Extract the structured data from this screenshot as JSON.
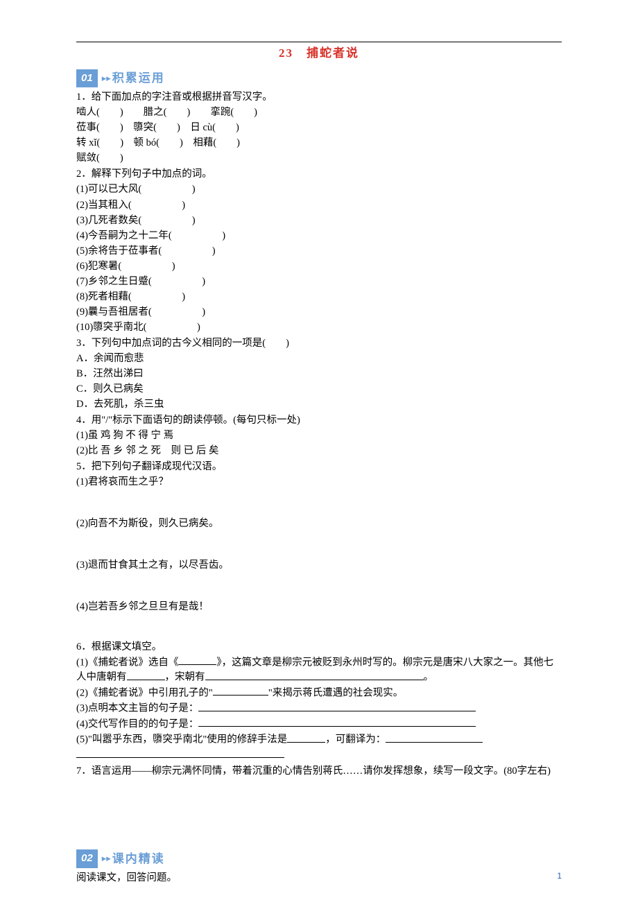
{
  "title": "23　捕蛇者说",
  "section01": {
    "num": "01",
    "label": "积累运用"
  },
  "section02": {
    "num": "02",
    "label": "课内精读"
  },
  "q1": {
    "stem": "1．给下面加点的字注音或根据拼音写汉字。",
    "row1": "啮人(　　)　　腊之(　　)　　挛踠(　　)",
    "row2": "莅事(　　)　隳突(　　)　日 cù(　　)",
    "row3": "转 xǐ(　　)　顿 bó(　　)　相藉(　　)",
    "row4": "赋敛(　　)"
  },
  "q2": {
    "stem": "2．解释下列句子中加点的词。",
    "i1": "(1)可以已大风(　　　　　)",
    "i2": "(2)当其租入(　　　　　)",
    "i3": "(3)几死者数矣(　　　　　)",
    "i4": "(4)今吾嗣为之十二年(　　　　　)",
    "i5": "(5)余将告于莅事者(　　　　　)",
    "i6": "(6)犯寒暑(　　　　　)",
    "i7": "(7)乡邻之生日蹙(　　　　　)",
    "i8": "(8)死者相藉(　　　　　)",
    "i9": "(9)曩与吾祖居者(　　　　　)",
    "i10": "(10)隳突乎南北(　　　　　)"
  },
  "q3": {
    "stem": "3．下列句中加点词的古今义相同的一项是(　　)",
    "a": "A．余闻而愈悲",
    "b": "B．汪然出涕曰",
    "c": "C．则久已病矣",
    "d": "D．去死肌，杀三虫"
  },
  "q4": {
    "stem": "4．用\"/\"标示下面语句的朗读停顿。(每句只标一处)",
    "i1": "(1)虽 鸡 狗 不 得 宁 焉",
    "i2": "(2)比 吾 乡 邻 之 死　则 已 后 矣"
  },
  "q5": {
    "stem": "5．把下列句子翻译成现代汉语。",
    "i1": "(1)君将哀而生之乎？",
    "i2": "(2)向吾不为斯役，则久已病矣。",
    "i3": "(3)退而甘食其土之有，以尽吾齿。",
    "i4": "(4)岂若吾乡邻之旦旦有是哉！"
  },
  "q6": {
    "stem": "6．根据课文填空。",
    "i1a": "(1)《捕蛇者说》选自《",
    "i1b": "》，这篇文章是柳宗元被贬到永州时写的。柳宗元是唐宋八大家之一。其他七人中唐朝有",
    "i1c": "，宋朝有",
    "i1d": "。",
    "i2a": "(2)《捕蛇者说》中引用孔子的\"",
    "i2b": "\"来揭示蒋氏遭遇的社会现实。",
    "i3": "(3)点明本文主旨的句子是：",
    "i4": "(4)交代写作目的的句子是：",
    "i5a": "(5)\"叫嚣乎东西，隳突乎南北\"使用的修辞手法是",
    "i5b": "，可翻译为："
  },
  "q7": "7．语言运用——柳宗元满怀同情，带着沉重的心情告别蒋氏……请你发挥想象，续写一段文字。(80字左右)",
  "s2text": "阅读课文，回答问题。",
  "pagenum": "1"
}
